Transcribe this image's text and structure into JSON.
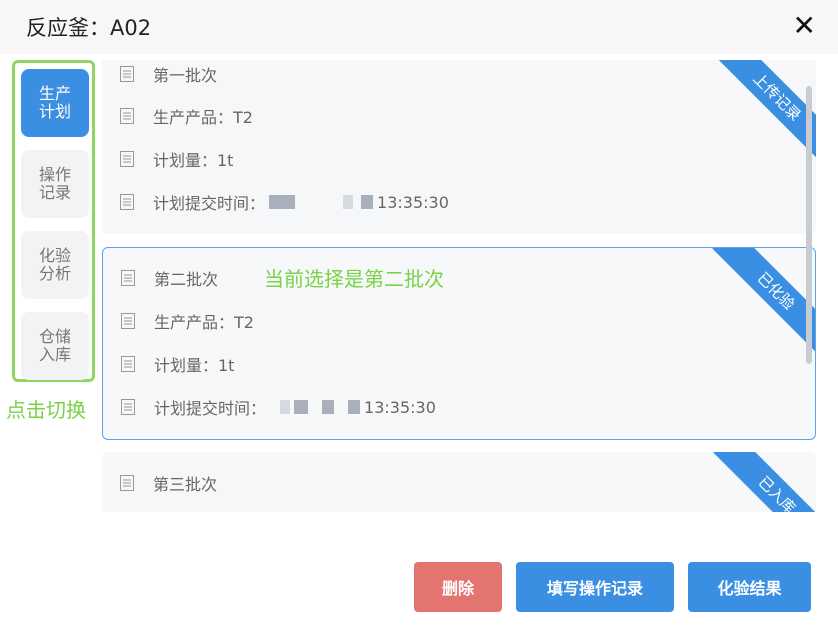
{
  "dialog": {
    "title": "反应釜：A02",
    "close_label": "✕"
  },
  "sidebar": {
    "items": [
      {
        "label": "生产计划",
        "active": true
      },
      {
        "label": "操作记录",
        "active": false
      },
      {
        "label": "化验分析",
        "active": false
      },
      {
        "label": "仓储入库",
        "active": false
      }
    ],
    "annotation": "点击切换"
  },
  "batches": [
    {
      "name": "第一批次",
      "product": "生产产品：T2",
      "quantity": "计划量：1t",
      "submit_label": "计划提交时间：",
      "submit_time": "13:35:30",
      "status": "上传记录"
    },
    {
      "name": "第二批次",
      "product": "生产产品：T2",
      "quantity": "计划量：1t",
      "submit_label": "计划提交时间：",
      "submit_time": "13:35:30",
      "status": "已化验",
      "annotation": "当前选择是第二批次"
    },
    {
      "name": "第三批次",
      "status": "已入库"
    }
  ],
  "actions": {
    "delete": "删除",
    "fill_record": "填写操作记录",
    "test_result": "化验结果"
  },
  "colors": {
    "primary": "#3b8fe3",
    "danger": "#e47470",
    "annotation": "#79d248"
  },
  "icons": {
    "close": "close-icon",
    "row": "document-icon"
  }
}
